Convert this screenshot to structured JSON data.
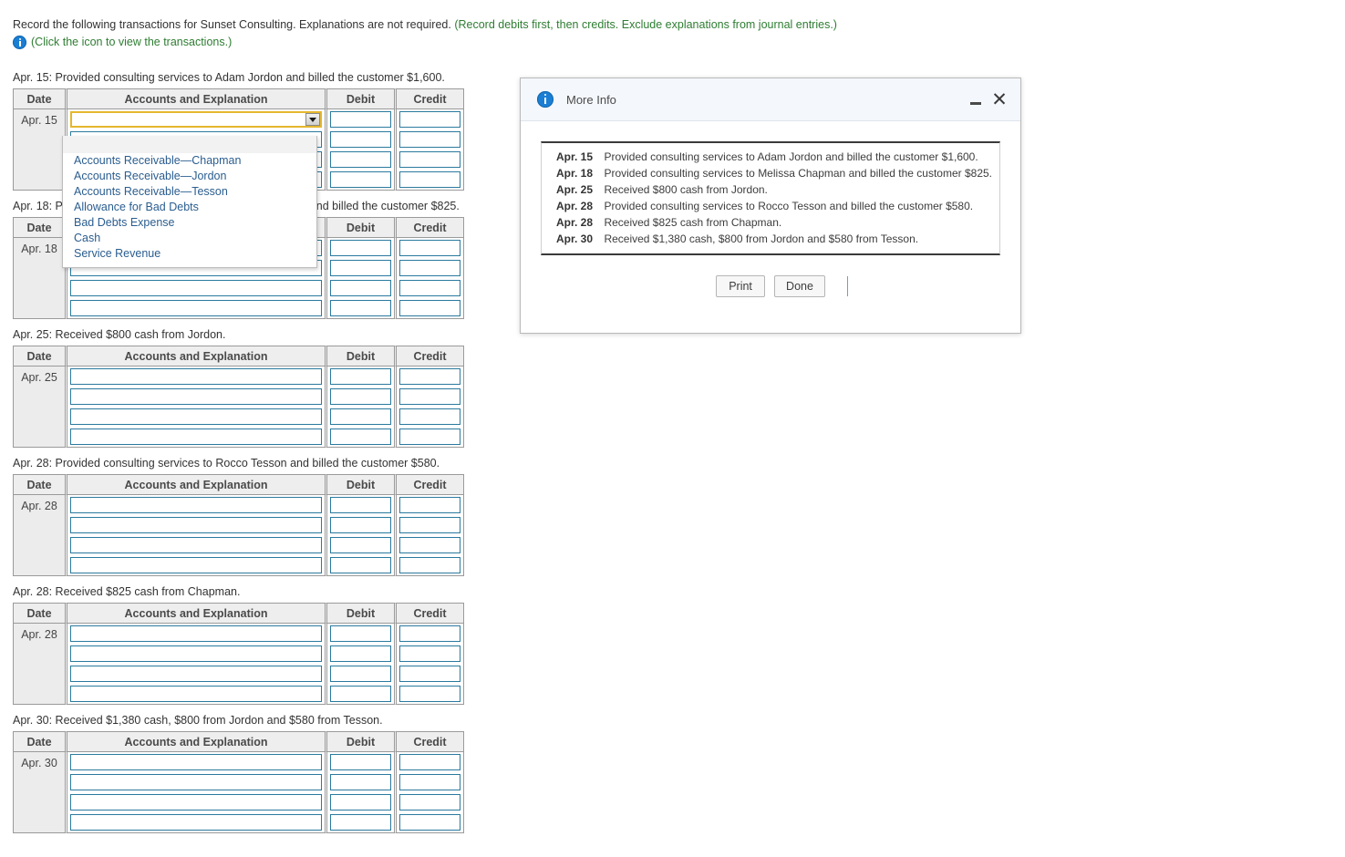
{
  "instructions": {
    "line1_black": "Record the following transactions for Sunset Consulting. Explanations are not required.",
    "line1_green": "(Record debits first, then credits. Exclude explanations from journal entries.)",
    "line2": "(Click the icon to view the transactions.)",
    "info_icon": "info-icon"
  },
  "journal_columns": {
    "date": "Date",
    "accounts": "Accounts and Explanation",
    "debit": "Debit",
    "credit": "Credit"
  },
  "journals": [
    {
      "caption": "Apr. 15: Provided consulting services to Adam Jordon and billed the customer $1,600.",
      "date": "Apr. 15",
      "rows": 4,
      "first_row_is_select": true,
      "select_value": ""
    },
    {
      "caption": "Apr. 18: Provided consulting services to Melissa Chapman and billed the customer $825.",
      "date": "Apr. 18",
      "rows": 4,
      "first_row_is_select": false,
      "select_value": ""
    },
    {
      "caption": "Apr. 25: Received $800 cash from Jordon.",
      "date": "Apr. 25",
      "rows": 4,
      "first_row_is_select": false,
      "select_value": ""
    },
    {
      "caption": "Apr. 28: Provided consulting services to Rocco Tesson and billed the customer $580.",
      "date": "Apr. 28",
      "rows": 4,
      "first_row_is_select": false,
      "select_value": ""
    },
    {
      "caption": "Apr. 28: Received $825 cash from Chapman.",
      "date": "Apr. 28",
      "rows": 4,
      "first_row_is_select": false,
      "select_value": ""
    },
    {
      "caption": "Apr. 30: Received $1,380 cash, $800 from Jordon and $580 from Tesson.",
      "date": "Apr. 30",
      "rows": 4,
      "first_row_is_select": false,
      "select_value": ""
    }
  ],
  "dropdown": {
    "open": true,
    "options": [
      "",
      "Accounts Receivable—Chapman",
      "Accounts Receivable—Jordon",
      "Accounts Receivable—Tesson",
      "Allowance for Bad Debts",
      "Bad Debts Expense",
      "Cash",
      "Service Revenue"
    ]
  },
  "dialog": {
    "title": "More Info",
    "info_icon": "info-icon",
    "minimize_label": "–",
    "close_label": "✕",
    "transactions": [
      {
        "date": "Apr. 15",
        "description": "Provided consulting services to Adam Jordon and billed the customer $1,600."
      },
      {
        "date": "Apr. 18",
        "description": "Provided consulting services to Melissa Chapman and billed the customer $825."
      },
      {
        "date": "Apr. 25",
        "description": "Received $800 cash from Jordon."
      },
      {
        "date": "Apr. 28",
        "description": "Provided consulting services to Rocco Tesson and billed the customer $580."
      },
      {
        "date": "Apr. 28",
        "description": "Received $825 cash from Chapman."
      },
      {
        "date": "Apr. 30",
        "description": "Received $1,380 cash, $800 from Jordon and $580 from Tesson."
      }
    ],
    "buttons": {
      "print": "Print",
      "done": "Done"
    }
  },
  "colors": {
    "input_border": "#2b7a9e",
    "select_focus_border": "#e5b72e",
    "green_text": "#2e7d32",
    "info_blue": "#1a7fd4",
    "header_bg": "#eeeeee",
    "dialog_titlebar": "#f4f7fc"
  }
}
